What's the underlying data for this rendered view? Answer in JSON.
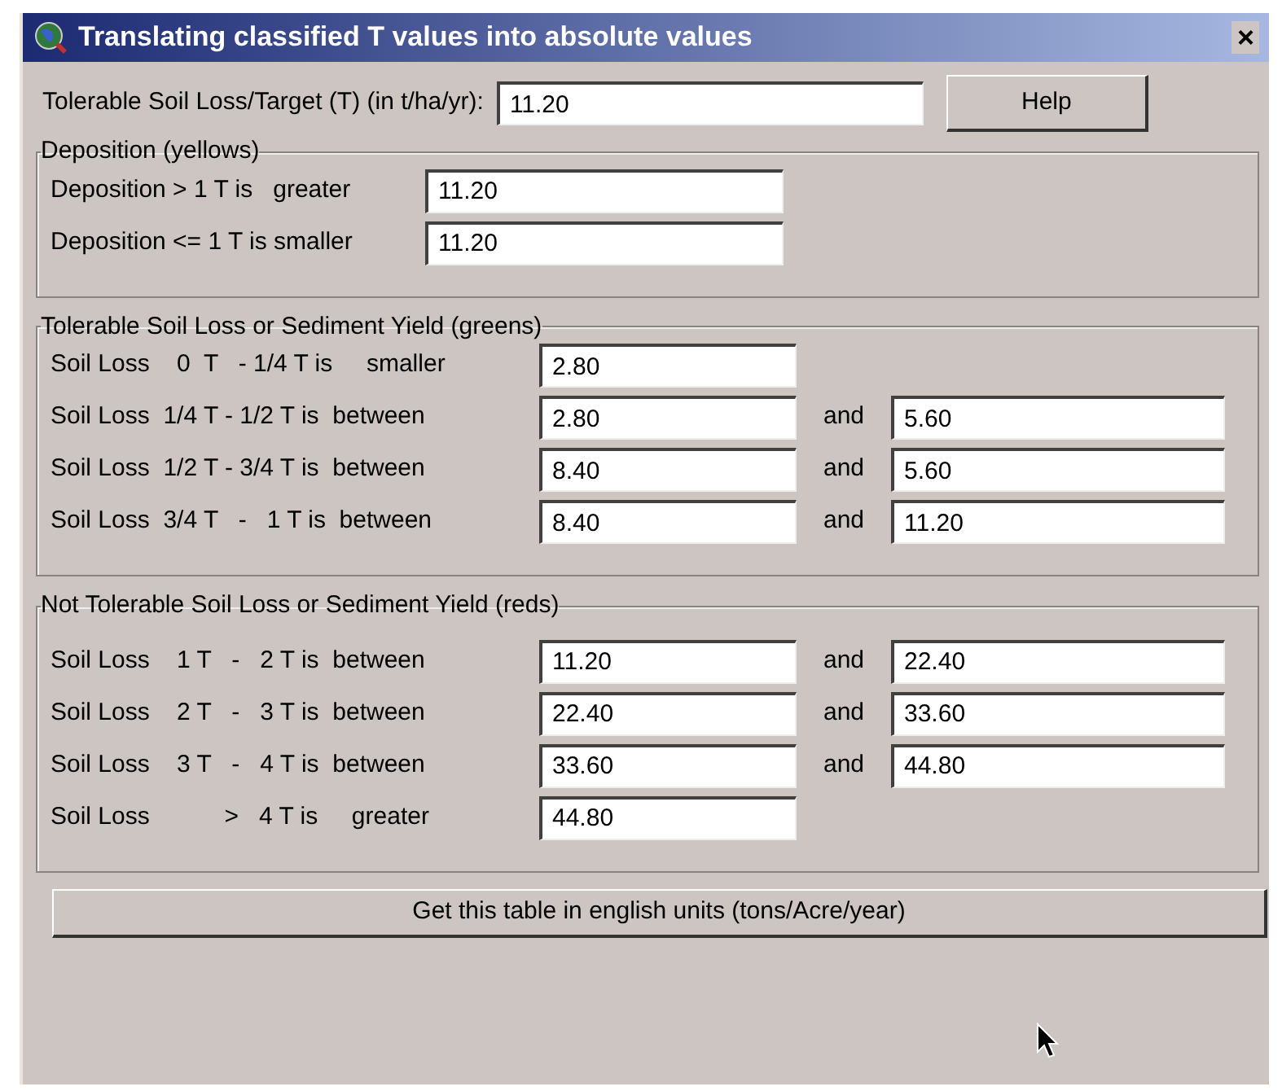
{
  "window": {
    "title": "Translating classified T values into absolute values",
    "close": "×"
  },
  "target": {
    "label": "Tolerable Soil Loss/Target (T) (in t/ha/yr):",
    "value": "11.20"
  },
  "help_button": "Help",
  "groups": [
    {
      "title": "Deposition  (yellows)",
      "kind": "deposition",
      "rows": [
        {
          "label": "Deposition > 1 T is   greater",
          "low": "11.20"
        },
        {
          "label": "Deposition <= 1 T is smaller",
          "low": "11.20"
        }
      ]
    },
    {
      "title": "Tolerable Soil Loss or Sediment Yield (greens)",
      "kind": "range",
      "rows": [
        {
          "label": "Soil Loss    0  T   - 1/4 T is     smaller",
          "low": "2.80"
        },
        {
          "label": "Soil Loss  1/4 T - 1/2 T is  between",
          "low": "2.80",
          "and": "and",
          "high": "5.60"
        },
        {
          "label": "Soil Loss  1/2 T - 3/4 T is  between",
          "low": "8.40",
          "and": "and",
          "high": "5.60"
        },
        {
          "label": "Soil Loss  3/4 T   -   1 T is  between",
          "low": "8.40",
          "and": "and",
          "high": "11.20"
        }
      ]
    },
    {
      "title": "Not Tolerable Soil Loss or Sediment Yield (reds)",
      "kind": "range",
      "rows": [
        {
          "label": "Soil Loss    1 T   -   2 T is  between",
          "low": "11.20",
          "and": "and",
          "high": "22.40"
        },
        {
          "label": "Soil Loss    2 T   -   3 T is  between",
          "low": "22.40",
          "and": "and",
          "high": "33.60"
        },
        {
          "label": "Soil Loss    3 T   -   4 T is  between",
          "low": "33.60",
          "and": "and",
          "high": "44.80"
        },
        {
          "label": "Soil Loss           >   4 T is     greater",
          "low": "44.80"
        }
      ]
    }
  ],
  "english_button": "Get this table in english units (tons/Acre/year)"
}
